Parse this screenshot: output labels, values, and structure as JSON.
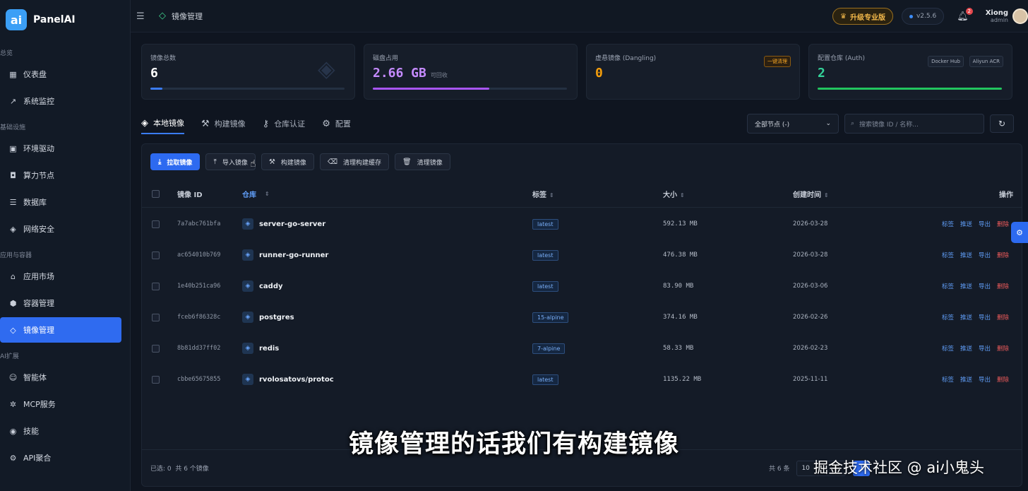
{
  "brand": {
    "logo": "ai",
    "name": "PanelAI"
  },
  "sidebar": {
    "groups": [
      {
        "title": "总览",
        "items": [
          {
            "label": "仪表盘",
            "icon": "grid-icon"
          },
          {
            "label": "系统监控",
            "icon": "trend-icon"
          }
        ]
      },
      {
        "title": "基础设施",
        "items": [
          {
            "label": "环境驱动",
            "icon": "chip-icon"
          },
          {
            "label": "算力节点",
            "icon": "cpu-icon"
          },
          {
            "label": "数据库",
            "icon": "database-icon"
          },
          {
            "label": "网络安全",
            "icon": "shield-icon"
          }
        ]
      },
      {
        "title": "应用与容器",
        "items": [
          {
            "label": "应用市场",
            "icon": "store-icon"
          },
          {
            "label": "容器管理",
            "icon": "box-icon"
          },
          {
            "label": "镜像管理",
            "icon": "layers-icon",
            "active": true
          }
        ]
      },
      {
        "title": "AI扩展",
        "items": [
          {
            "label": "智能体",
            "icon": "robot-icon"
          },
          {
            "label": "MCP服务",
            "icon": "network-icon"
          },
          {
            "label": "技能",
            "icon": "skill-icon"
          },
          {
            "label": "API聚合",
            "icon": "api-icon"
          }
        ]
      }
    ]
  },
  "topbar": {
    "breadcrumb": "镜像管理",
    "upgrade": "升级专业版",
    "version": "v2.5.6",
    "notifications": "2",
    "user_name": "Xiong",
    "user_role": "admin"
  },
  "cards": {
    "total": {
      "label": "镜像总数",
      "value": "6",
      "progress": 0.06,
      "color": "#3b7cf6"
    },
    "disk": {
      "label": "磁盘占用",
      "value": "2.66 GB",
      "sub": "可回收",
      "progress": 0.6,
      "color": "#a855f7"
    },
    "dangling": {
      "label": "虚悬镜像 (Dangling)",
      "value": "0",
      "action": "一键清理",
      "color": "#f59e0b"
    },
    "registry": {
      "label": "配置仓库 (Auth)",
      "value": "2",
      "chips": [
        "Docker Hub",
        "Aliyun ACR"
      ],
      "progress": 1.0,
      "color": "#22c55e"
    }
  },
  "tabs": [
    "本地镜像",
    "构建镜像",
    "仓库认证",
    "配置"
  ],
  "filters": {
    "node": "全部节点 (-)",
    "search_placeholder": "搜索镜像 ID / 名称..."
  },
  "toolbar": [
    "拉取镜像",
    "导入镜像",
    "构建镜像",
    "清理构建缓存",
    "清理镜像"
  ],
  "table": {
    "headers": [
      "镜像 ID",
      "仓库",
      "标签",
      "大小",
      "创建时间",
      "操作"
    ],
    "actions": [
      "标签",
      "推送",
      "导出",
      "删除"
    ],
    "rows": [
      {
        "id": "7a7abc761bfa",
        "repo": "server-go-server",
        "tag": "latest",
        "size": "592.13 MB",
        "date": "2026-03-28"
      },
      {
        "id": "ac654010b769",
        "repo": "runner-go-runner",
        "tag": "latest",
        "size": "476.38 MB",
        "date": "2026-03-28"
      },
      {
        "id": "1e40b251ca96",
        "repo": "caddy",
        "tag": "latest",
        "size": "83.90 MB",
        "date": "2026-03-06"
      },
      {
        "id": "fceb6f86328c",
        "repo": "postgres",
        "tag": "15-alpine",
        "size": "374.16 MB",
        "date": "2026-02-26"
      },
      {
        "id": "8b81dd37ff02",
        "repo": "redis",
        "tag": "7-alpine",
        "size": "58.33 MB",
        "date": "2026-02-23"
      },
      {
        "id": "cbbe65675855",
        "repo": "rvolosatovs/protoc",
        "tag": "latest",
        "size": "1135.22 MB",
        "date": "2025-11-11"
      }
    ]
  },
  "footer": {
    "selected": "已选: 0",
    "total_images": "共 6 个镜像",
    "total": "共 6 条",
    "page_size": "10",
    "page": "1"
  },
  "overlay": {
    "subtitle": "镜像管理的话我们有构建镜像",
    "watermark": "掘金技术社区 @ ai小鬼头"
  }
}
